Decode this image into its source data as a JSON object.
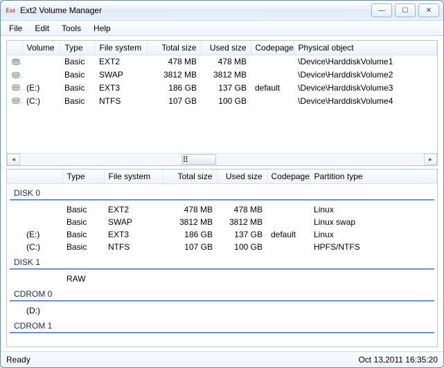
{
  "window": {
    "app_icon_text": "Ext",
    "title": "Ext2 Volume Manager",
    "btn_min": "—",
    "btn_max": "☐",
    "btn_close": "✕"
  },
  "menu": {
    "file": "File",
    "edit": "Edit",
    "tools": "Tools",
    "help": "Help"
  },
  "top_table": {
    "headers": {
      "volume": "Volume",
      "type": "Type",
      "fs": "File system",
      "total": "Total size",
      "used": "Used size",
      "codepage": "Codepage",
      "phys": "Physical object"
    },
    "rows": [
      {
        "icon": "vol",
        "volume": "",
        "type": "Basic",
        "fs": "EXT2",
        "total": "478 MB",
        "used": "478 MB",
        "codepage": "",
        "phys": "\\Device\\HarddiskVolume1"
      },
      {
        "icon": "vol",
        "volume": "",
        "type": "Basic",
        "fs": "SWAP",
        "total": "3812 MB",
        "used": "3812 MB",
        "codepage": "",
        "phys": "\\Device\\HarddiskVolume2"
      },
      {
        "icon": "vol",
        "volume": "(E:)",
        "type": "Basic",
        "fs": "EXT3",
        "total": "186 GB",
        "used": "137 GB",
        "codepage": "default",
        "phys": "\\Device\\HarddiskVolume3"
      },
      {
        "icon": "vol",
        "volume": "(C:)",
        "type": "Basic",
        "fs": "NTFS",
        "total": "107 GB",
        "used": "100 GB",
        "codepage": "",
        "phys": "\\Device\\HarddiskVolume4"
      }
    ]
  },
  "bottom_table": {
    "headers": {
      "spacer": "",
      "type": "Type",
      "fs": "File system",
      "total": "Total size",
      "used": "Used size",
      "codepage": "Codepage",
      "ptype": "Partition type"
    },
    "disks": [
      {
        "label": "DISK 0",
        "rows": [
          {
            "vol": "",
            "type": "Basic",
            "fs": "EXT2",
            "total": "478 MB",
            "used": "478 MB",
            "codepage": "",
            "ptype": "Linux"
          },
          {
            "vol": "",
            "type": "Basic",
            "fs": "SWAP",
            "total": "3812 MB",
            "used": "3812 MB",
            "codepage": "",
            "ptype": "Linux swap"
          },
          {
            "vol": "(E:)",
            "type": "Basic",
            "fs": "EXT3",
            "total": "186 GB",
            "used": "137 GB",
            "codepage": "default",
            "ptype": "Linux"
          },
          {
            "vol": "(C:)",
            "type": "Basic",
            "fs": "NTFS",
            "total": "107 GB",
            "used": "100 GB",
            "codepage": "",
            "ptype": "HPFS/NTFS"
          }
        ]
      },
      {
        "label": "DISK 1",
        "rows": [
          {
            "vol": "",
            "type": "RAW",
            "fs": "",
            "total": "",
            "used": "",
            "codepage": "",
            "ptype": ""
          }
        ]
      },
      {
        "label": "CDROM 0",
        "rows": [
          {
            "vol": "(D:)",
            "type": "",
            "fs": "",
            "total": "",
            "used": "",
            "codepage": "",
            "ptype": ""
          }
        ]
      },
      {
        "label": "CDROM 1",
        "rows": []
      }
    ]
  },
  "status": {
    "left": "Ready",
    "right": "Oct 13,2011 16:35:20"
  }
}
